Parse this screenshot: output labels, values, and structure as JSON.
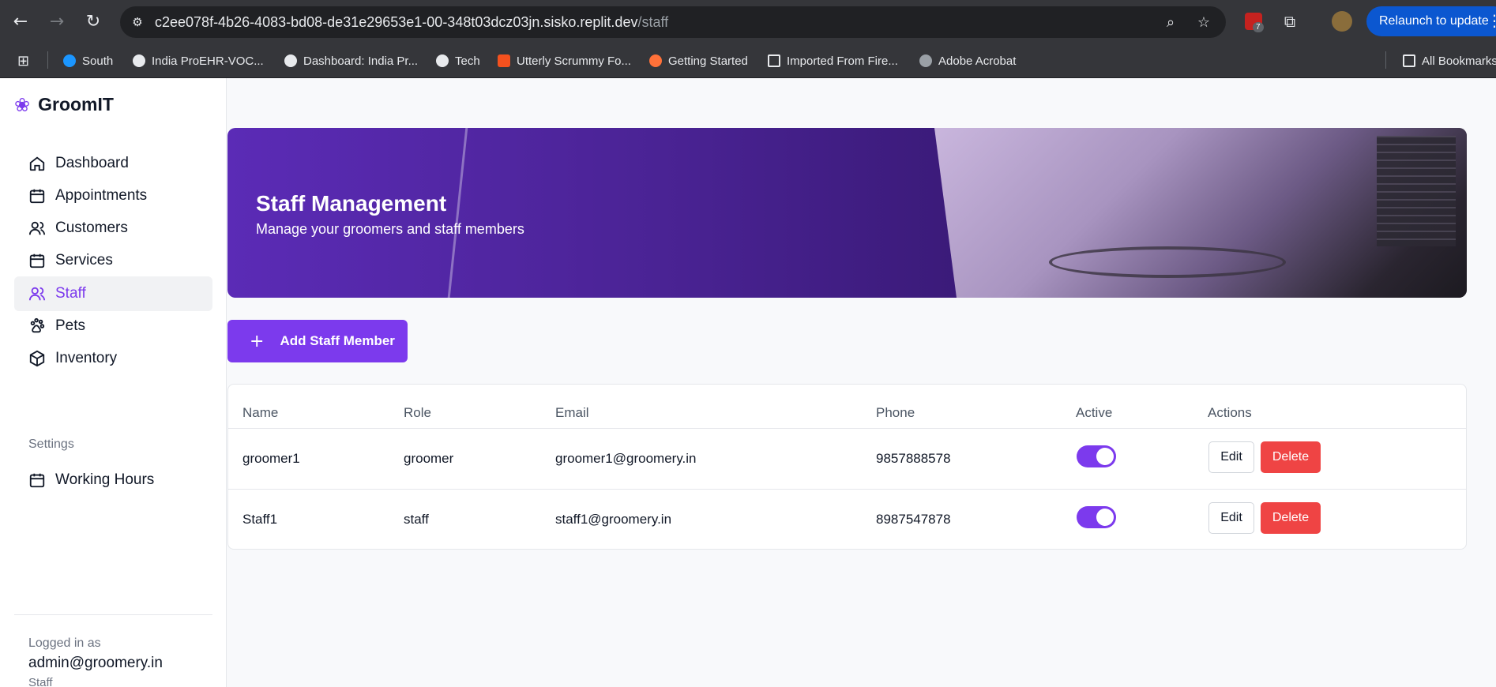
{
  "browser": {
    "url_host": "c2ee078f-4b26-4083-bd08-de31e29653e1-00-348t03dcz03jn.sisko.replit.dev",
    "url_path": "/staff",
    "extension_badge": "7",
    "relaunch_label": "Relaunch to update",
    "bookmarks": [
      "South",
      "India ProEHR-VOC...",
      "Dashboard: India Pr...",
      "Tech",
      "Utterly Scrummy Fo...",
      "Getting Started",
      "Imported From Fire...",
      "Adobe Acrobat"
    ],
    "all_bookmarks": "All Bookmarks"
  },
  "app": {
    "brand": "GroomIT",
    "nav": [
      "Dashboard",
      "Appointments",
      "Customers",
      "Services",
      "Staff",
      "Pets",
      "Inventory"
    ],
    "settings_label": "Settings",
    "settings_nav": [
      "Working Hours"
    ],
    "logged_in_label": "Logged in as",
    "logged_in_user": "admin@groomery.in",
    "logged_in_role": "Staff"
  },
  "page": {
    "title": "Staff Management",
    "subtitle": "Manage your groomers and staff members",
    "add_button": "Add Staff Member",
    "columns": [
      "Name",
      "Role",
      "Email",
      "Phone",
      "Active",
      "Actions"
    ],
    "rows": [
      {
        "name": "groomer1",
        "role": "groomer",
        "email": "groomer1@groomery.in",
        "phone": "9857888578",
        "active": true
      },
      {
        "name": "Staff1",
        "role": "staff",
        "email": "staff1@groomery.in",
        "phone": "8987547878",
        "active": true
      }
    ],
    "edit_label": "Edit",
    "delete_label": "Delete"
  },
  "colors": {
    "accent": "#7c3aed",
    "danger": "#ef4444"
  }
}
